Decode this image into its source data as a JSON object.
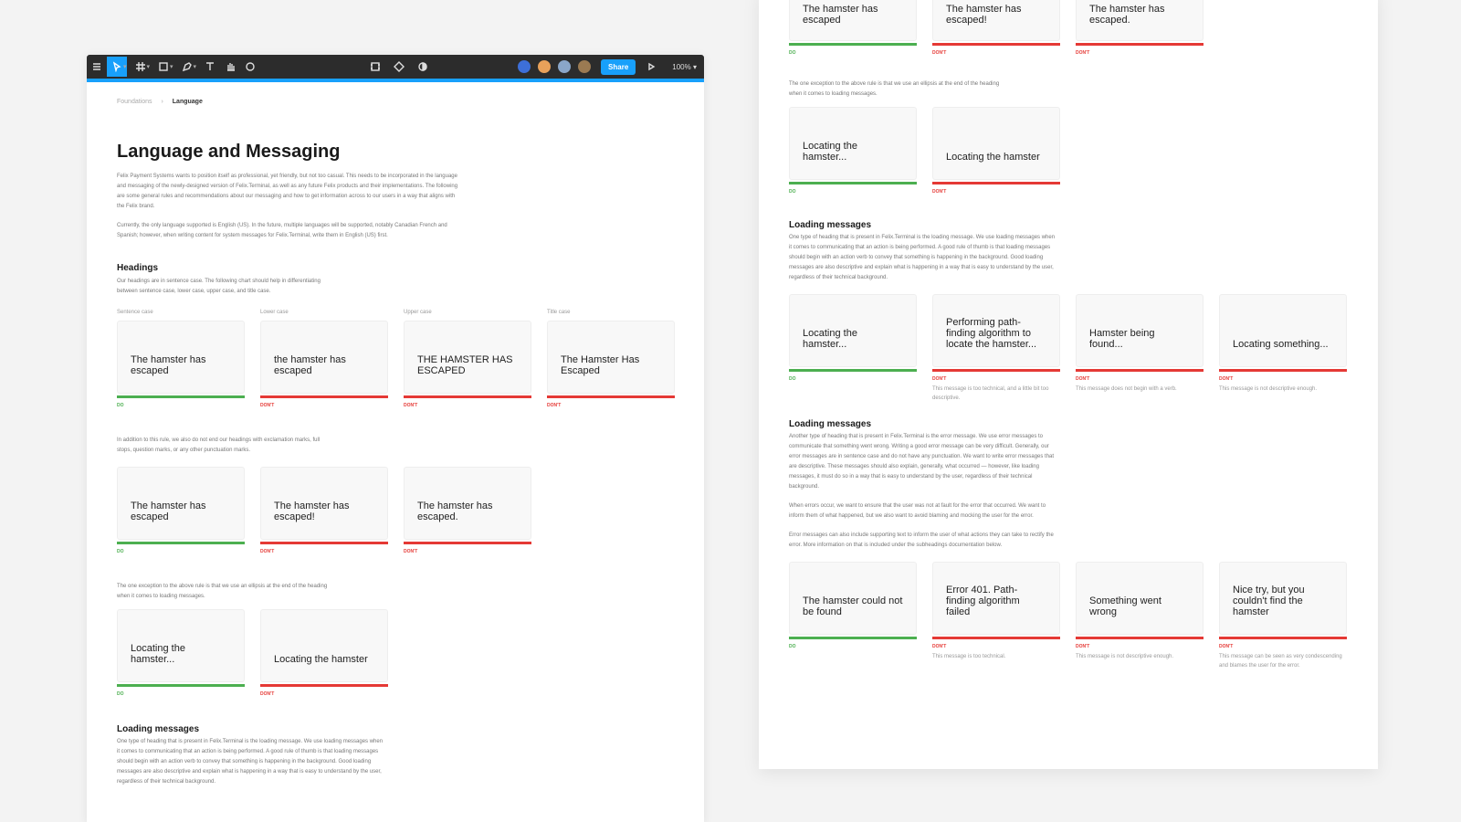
{
  "toolbar": {
    "share_label": "Share",
    "zoom": "100%",
    "avatar_colors": [
      "#3d6fd8",
      "#e8a15a",
      "#8aa6c9",
      "#9b7a52"
    ]
  },
  "breadcrumb": {
    "parent": "Foundations",
    "current": "Language"
  },
  "page": {
    "title": "Language and Messaging",
    "intro1": "Felix Payment Systems wants to position itself as professional, yet friendly, but not too casual. This needs to be incorporated in the language and messaging of the newly-designed version of Felix.Terminal, as well as any future Felix products and their implementations. The following are some general rules and recommendations about our messaging and how to get information across to our users in a way that aligns with the Felix brand.",
    "intro2": "Currently, the only language supported is English (US). In the future, multiple languages will be supported, notably Canadian French and Spanish; however, when writing content for system messages for Felix.Terminal, write them in English (US) first."
  },
  "headings": {
    "title": "Headings",
    "desc": "Our headings are in sentence case. The following chart should help in differentiating between sentence case, lower case, upper case, and title case.",
    "cases": [
      {
        "caption": "Sentence case",
        "text": "The hamster has escaped",
        "verdict": "DO",
        "ok": true
      },
      {
        "caption": "Lower case",
        "text": "the hamster has escaped",
        "verdict": "DON'T",
        "ok": false
      },
      {
        "caption": "Upper case",
        "text": "THE HAMSTER HAS ESCAPED",
        "verdict": "DON'T",
        "ok": false
      },
      {
        "caption": "Title case",
        "text": "The Hamster Has Escaped",
        "verdict": "DON'T",
        "ok": false
      }
    ],
    "punct_desc": "In addition to this rule, we also do not end our headings with exclamation marks, full stops, question marks, or any other punctuation marks.",
    "punct": [
      {
        "text": "The hamster has escaped",
        "verdict": "DO",
        "ok": true
      },
      {
        "text": "The hamster has escaped!",
        "verdict": "DON'T",
        "ok": false
      },
      {
        "text": "The hamster has escaped.",
        "verdict": "DON'T",
        "ok": false
      }
    ],
    "ellipsis_desc": "The one exception to the above rule is that we use an ellipsis at the end of the heading when it comes to loading messages.",
    "ellipsis": [
      {
        "text": "Locating the hamster...",
        "verdict": "DO",
        "ok": true
      },
      {
        "text": "Locating the hamster",
        "verdict": "DON'T",
        "ok": false
      }
    ]
  },
  "loading": {
    "title": "Loading messages",
    "desc": "One type of heading that is present in Felix.Terminal is the loading message. We use loading messages when it comes to communicating that an action is being performed. A good rule of thumb is that loading messages should begin with an action verb to convey that something is happening in the background. Good loading messages are also descriptive and explain what is happening in a way that is easy to understand by the user, regardless of their technical background.",
    "examples": [
      {
        "text": "Locating the hamster...",
        "verdict": "DO",
        "ok": true,
        "note": ""
      },
      {
        "text": "Performing path-finding algorithm to locate the hamster...",
        "verdict": "DON'T",
        "ok": false,
        "note": "This message is too technical, and a little bit too descriptive."
      },
      {
        "text": "Hamster being found...",
        "verdict": "DON'T",
        "ok": false,
        "note": "This message does not begin with a verb."
      },
      {
        "text": "Locating something...",
        "verdict": "DON'T",
        "ok": false,
        "note": "This message is not descriptive enough."
      }
    ]
  },
  "errors": {
    "title": "Loading messages",
    "desc1": "Another type of heading that is present in Felix.Terminal is the error message. We use error messages to communicate that something went wrong. Writing a good error message can be very difficult. Generally, our error messages are in sentence case and do not have any punctuation. We want to write error messages that are descriptive. These messages should also explain, generally, what occurred — however, like loading messages, it must do so in a way that is easy to understand by the user, regardless of their technical background.",
    "desc2": "When errors occur, we want to ensure that the user was not at fault for the error that occurred. We want to inform them of what happened, but we also want to avoid blaming and mocking the user for the error.",
    "desc3": "Error messages can also include supporting text to inform the user of what actions they can take to rectify the error. More information on that is included under the subheadings documentation below.",
    "examples": [
      {
        "text": "The hamster could not be found",
        "verdict": "DO",
        "ok": true,
        "note": ""
      },
      {
        "text": "Error 401. Path-finding algorithm failed",
        "verdict": "DON'T",
        "ok": false,
        "note": "This message is too technical."
      },
      {
        "text": "Something went wrong",
        "verdict": "DON'T",
        "ok": false,
        "note": "This message is not descriptive enough."
      },
      {
        "text": "Nice try, but you couldn't find the hamster",
        "verdict": "DON'T",
        "ok": false,
        "note": "This message can be seen as very condescending and blames the user for the error."
      }
    ]
  }
}
